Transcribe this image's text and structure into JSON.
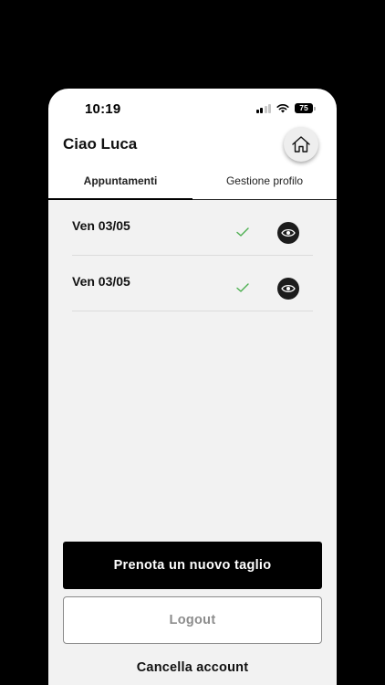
{
  "status_bar": {
    "time": "10:19",
    "battery": "75",
    "icons": [
      "signal-icon",
      "wifi-icon",
      "battery-icon"
    ]
  },
  "header": {
    "title": "Ciao Luca",
    "home_icon": "home-icon"
  },
  "tabs": [
    {
      "label": "Appuntamenti",
      "active": true
    },
    {
      "label": "Gestione profilo",
      "active": false
    }
  ],
  "appointments": [
    {
      "date": "Ven 03/05",
      "status_icon": "check-icon",
      "action_icon": "eye-icon"
    },
    {
      "date": "Ven 03/05",
      "status_icon": "check-icon",
      "action_icon": "eye-icon"
    }
  ],
  "actions": {
    "book_label": "Prenota un nuovo taglio",
    "logout_label": "Logout",
    "delete_label": "Cancella account"
  },
  "colors": {
    "check": "#4caf50",
    "primary": "#000000",
    "background": "#f2f2f2"
  }
}
